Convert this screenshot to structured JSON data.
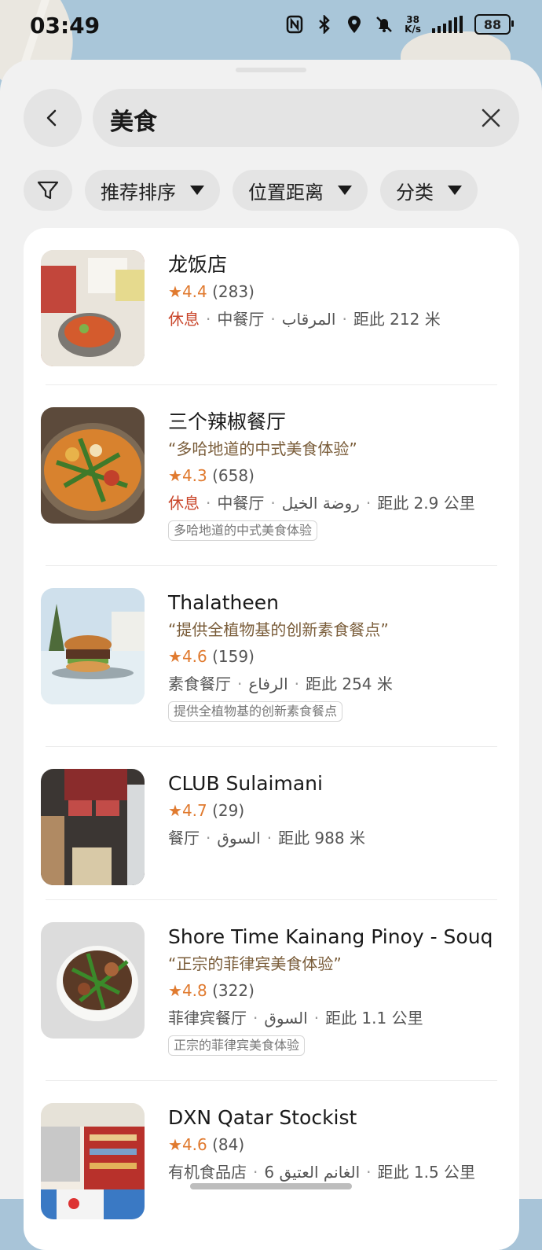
{
  "status_bar": {
    "time": "03:49",
    "net_speed_top": "38",
    "net_speed_bottom": "K/s",
    "battery": "88"
  },
  "search": {
    "query": "美食"
  },
  "filters": [
    {
      "label": "推荐排序"
    },
    {
      "label": "位置距离"
    },
    {
      "label": "分类"
    }
  ],
  "results": [
    {
      "name": "龙饭店",
      "tagline": "",
      "score": "4.4",
      "count": "(283)",
      "status": "休息",
      "category": "中餐厅",
      "area": "المرقاب",
      "distance": "距此 212 米",
      "badge": ""
    },
    {
      "name": "三个辣椒餐厅",
      "tagline": "“多哈地道的中式美食体验”",
      "score": "4.3",
      "count": "(658)",
      "status": "休息",
      "category": "中餐厅",
      "area": "روضة الخيل",
      "distance": "距此 2.9 公里",
      "badge": "多哈地道的中式美食体验"
    },
    {
      "name": "Thalatheen",
      "tagline": "“提供全植物基的创新素食餐点”",
      "score": "4.6",
      "count": "(159)",
      "status": "",
      "category": "素食餐厅",
      "area": "الرفاع",
      "distance": "距此 254 米",
      "badge": "提供全植物基的创新素食餐点"
    },
    {
      "name": "CLUB Sulaimani",
      "tagline": "",
      "score": "4.7",
      "count": "(29)",
      "status": "",
      "category": "餐厅",
      "area": "السوق",
      "distance": "距此 988 米",
      "badge": ""
    },
    {
      "name": "Shore Time Kainang Pinoy - Souq",
      "tagline": "“正宗的菲律宾美食体验”",
      "score": "4.8",
      "count": "(322)",
      "status": "",
      "category": "菲律宾餐厅",
      "area": "السوق",
      "distance": "距此 1.1 公里",
      "badge": "正宗的菲律宾美食体验"
    },
    {
      "name": "DXN Qatar Stockist",
      "tagline": "",
      "score": "4.6",
      "count": "(84)",
      "status": "",
      "category": "有机食品店",
      "area": "الغانم العتيق 6",
      "distance": "距此 1.5 公里",
      "badge": ""
    }
  ],
  "icons": {
    "back": "chevron-left-icon",
    "clear": "close-icon",
    "filter": "filter-funnel-icon",
    "star": "star-icon"
  },
  "colors": {
    "rating": "#e07a2f",
    "closed": "#c9462b",
    "tagline": "#7a5d3a"
  }
}
